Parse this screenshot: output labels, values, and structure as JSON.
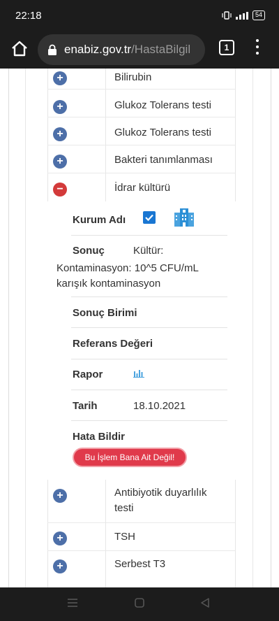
{
  "status_bar": {
    "time": "22:18",
    "battery": "54",
    "icons": [
      "vibrate-icon",
      "signal-icon",
      "battery-icon"
    ]
  },
  "browser": {
    "url_host": "enabiz.gov.tr",
    "url_path": "/HastaBilgil",
    "tab_count": "1",
    "icons": [
      "home-icon",
      "lock-icon",
      "menu-icon"
    ]
  },
  "test_list_top": [
    {
      "label": "Bilirubin",
      "expanded": false
    },
    {
      "label": "Glukoz Tolerans testi",
      "expanded": false
    },
    {
      "label": "Glukoz Tolerans testi",
      "expanded": false
    },
    {
      "label": "Bakteri tanımlanması",
      "expanded": false
    },
    {
      "label": "İdrar kültürü",
      "expanded": true
    }
  ],
  "detail": {
    "institution_label": "Kurum Adı",
    "result_label": "Sonuç",
    "result_value_line1": "Kültür:",
    "result_value_line2": "Kontaminasyon: 10^5 CFU/mL",
    "result_value_line3": "karışık kontaminasyon",
    "unit_label": "Sonuç Birimi",
    "reference_label": "Referans Değeri",
    "report_label": "Rapor",
    "date_label": "Tarih",
    "date_value": "18.10.2021",
    "report_error_label": "Hata Bildir",
    "report_error_button": "Bu İşlem Bana Ait Değil!",
    "accent_color": "#e03a4b"
  },
  "test_list_bottom": [
    {
      "label_line1": "Antibiyotik duyarlılık",
      "label_line2": "testi"
    },
    {
      "label_line1": "TSH",
      "label_line2": ""
    },
    {
      "label_line1": "Serbest T3",
      "label_line2": ""
    }
  ],
  "colors": {
    "expand_toggle": "#4d6fa8",
    "collapse_toggle": "#d33a3a",
    "checkbox": "#1976d2"
  }
}
